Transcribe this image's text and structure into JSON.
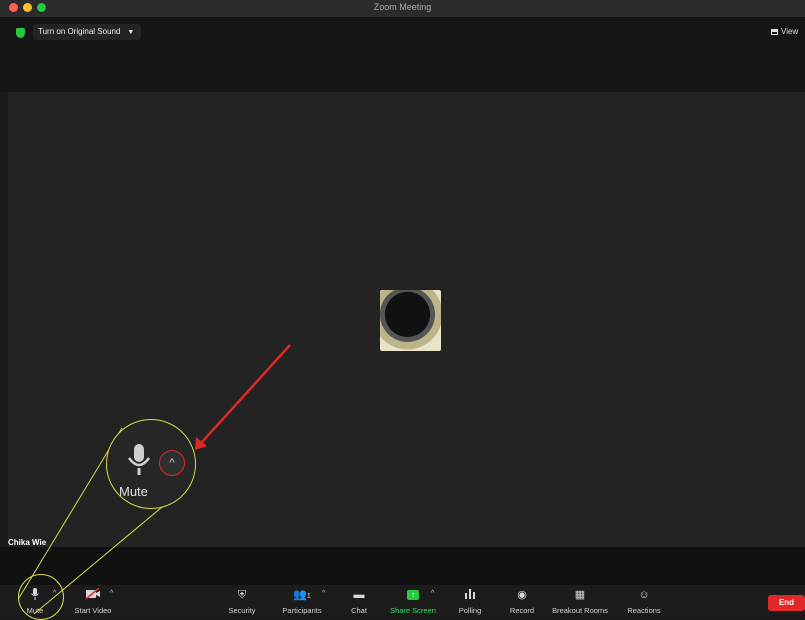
{
  "window": {
    "title": "Zoom Meeting"
  },
  "top_bar": {
    "original_sound_label": "Turn on Original Sound",
    "view_label": "View"
  },
  "participant": {
    "name": "Chika Wie"
  },
  "callout": {
    "label": "Mute"
  },
  "toolbar": {
    "mute": "Mute",
    "start_video": "Start Video",
    "security": "Security",
    "participants": "Participants",
    "participants_count": "1",
    "chat": "Chat",
    "share_screen": "Share Screen",
    "polling": "Polling",
    "record": "Record",
    "breakout_rooms": "Breakout Rooms",
    "reactions": "Reactions",
    "end": "End"
  },
  "colors": {
    "end_button": "#e02828",
    "share_green": "#27c93f",
    "annotation_yellow": "#d8d84a",
    "annotation_arrow": "#e02828"
  }
}
